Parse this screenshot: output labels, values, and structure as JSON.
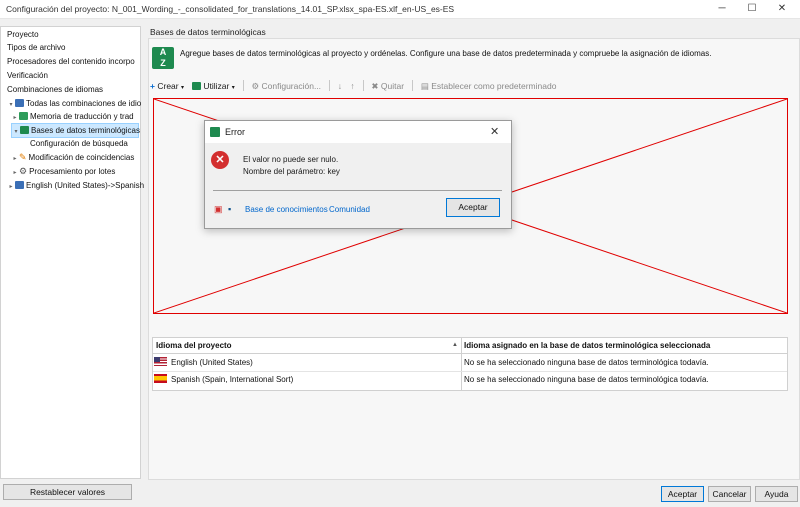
{
  "window": {
    "title": "Configuración del proyecto: N_001_Wording_-_consolidated_for_translations_14.01_SP.xlsx_spa-ES.xlf_en-US_es-ES",
    "minimize": "─",
    "maximize": "☐",
    "close": "✕"
  },
  "sidebar": {
    "items": [
      {
        "label": "Proyecto"
      },
      {
        "label": "Tipos de archivo"
      },
      {
        "label": "Procesadores del contenido incorpo"
      },
      {
        "label": "Verificación"
      },
      {
        "label": "Combinaciones de idiomas"
      },
      {
        "label": "Todas las combinaciones de idio"
      },
      {
        "label": "Memoria de traducción y trad"
      },
      {
        "label": "Bases de datos terminológicas"
      },
      {
        "label": "Configuración de búsqueda"
      },
      {
        "label": "Modificación de coincidencias"
      },
      {
        "label": "Procesamiento por lotes"
      },
      {
        "label": "English (United States)->Spanish"
      }
    ]
  },
  "main": {
    "section_title": "Bases de datos terminológicas",
    "icon_text_top": "A",
    "icon_text_bottom": "Z",
    "description": "Agregue bases de datos terminológicas al proyecto y ordénelas. Configure una base de datos predeterminada y compruebe la asignación de idiomas.",
    "toolbar": {
      "create": "Crear",
      "use": "Utilizar",
      "configuration": "Configuración...",
      "remove": "Quitar",
      "set_default": "Establecer como predeterminado"
    }
  },
  "language_grid": {
    "columns": [
      "Idioma del proyecto",
      "Idioma asignado en la base de datos terminológica seleccionada"
    ],
    "rows": [
      {
        "language": "English (United States)",
        "assigned": "No se ha seleccionado ninguna base de datos terminológica todavía."
      },
      {
        "language": "Spanish (Spain, International Sort)",
        "assigned": "No se ha seleccionado ninguna base de datos terminológica todavía."
      }
    ]
  },
  "footer": {
    "reset": "Restablecer valores",
    "accept": "Aceptar",
    "cancel": "Cancelar",
    "help": "Ayuda"
  },
  "error_dialog": {
    "title": "Error",
    "message_line1": "El valor no puede ser nulo.",
    "message_line2": "Nombre del parámetro: key",
    "knowledge_base": "Base de conocimientos",
    "community": "Comunidad",
    "accept": "Aceptar",
    "close": "✕"
  },
  "colors": {
    "accent": "#0078d7",
    "error_red": "#d32f2f",
    "brand_green": "#1e8a4f",
    "placeholder_red": "#e00000"
  }
}
